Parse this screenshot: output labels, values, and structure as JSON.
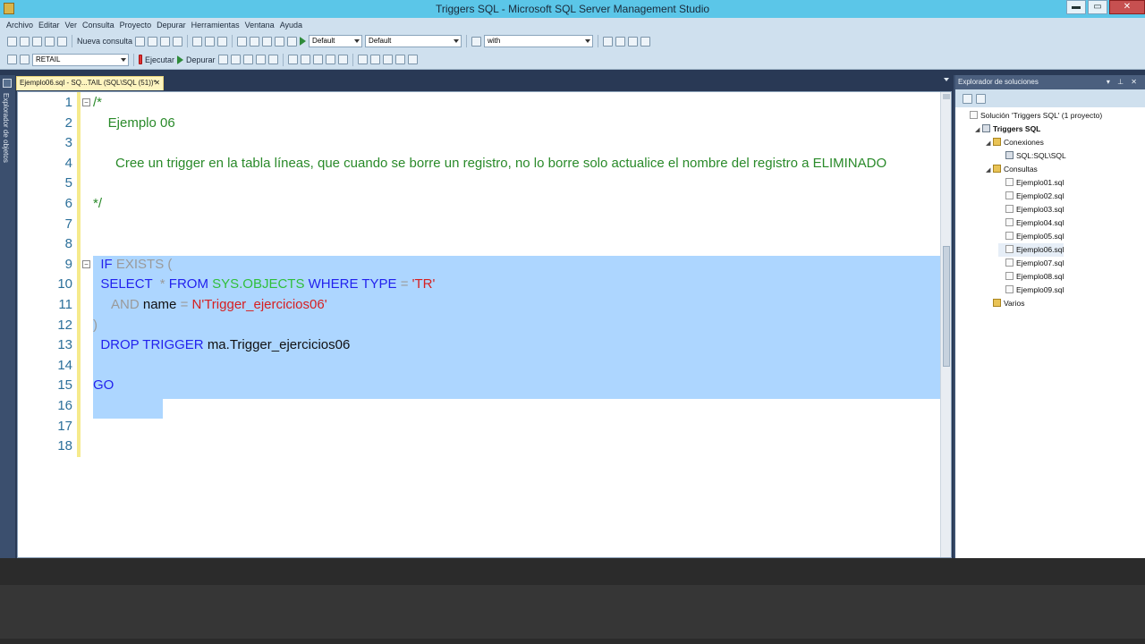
{
  "window": {
    "title": "Triggers SQL - Microsoft SQL Server Management Studio",
    "minimize": "▬",
    "restore": "▭",
    "close": "✕"
  },
  "menu": [
    "Archivo",
    "Editar",
    "Ver",
    "Consulta",
    "Proyecto",
    "Depurar",
    "Herramientas",
    "Ventana",
    "Ayuda"
  ],
  "toolbar1": {
    "new_query": "Nueva consulta",
    "combo1": "Default",
    "combo2": "Default",
    "search": "with"
  },
  "toolbar2": {
    "database": "RETAIL",
    "execute": "Ejecutar",
    "debug": "Depurar"
  },
  "left_strip": {
    "label": "Explorador de objetos"
  },
  "tab": {
    "label": "Ejemplo06.sql - SQ...TAIL (SQL\\SQL (51))*",
    "close": "✕"
  },
  "editor": {
    "line_numbers": [
      "1",
      "2",
      "3",
      "4",
      "5",
      "6",
      "7",
      "8",
      "9",
      "10",
      "11",
      "12",
      "13",
      "14",
      "15",
      "16",
      "17",
      "18"
    ],
    "lines": [
      [
        {
          "t": "/*",
          "c": "cm"
        }
      ],
      [
        {
          "t": "    Ejemplo 06",
          "c": "cm"
        }
      ],
      [],
      [
        {
          "t": "      Cree un trigger en la tabla líneas, que cuando se borre un registro, no lo borre solo actualice el nombre del registro a ELIMINADO",
          "c": "cm"
        }
      ],
      [],
      [
        {
          "t": "*/",
          "c": "cm"
        }
      ],
      [],
      [],
      [
        {
          "t": "  IF ",
          "c": "kw"
        },
        {
          "t": "EXISTS (",
          "c": "gr"
        }
      ],
      [
        {
          "t": "  SELECT  ",
          "c": "kw"
        },
        {
          "t": "* ",
          "c": "gr"
        },
        {
          "t": "FROM ",
          "c": "kw"
        },
        {
          "t": "SYS.OBJECTS ",
          "c": "sys"
        },
        {
          "t": "WHERE TYPE ",
          "c": "kw"
        },
        {
          "t": "= ",
          "c": "gr"
        },
        {
          "t": "'TR'",
          "c": "str"
        }
      ],
      [
        {
          "t": "     AND ",
          "c": "gr"
        },
        {
          "t": "name ",
          "c": "pl"
        },
        {
          "t": "= ",
          "c": "gr"
        },
        {
          "t": "N'Trigger_ejercicios06'",
          "c": "str"
        }
      ],
      [
        {
          "t": ")",
          "c": "gr"
        }
      ],
      [
        {
          "t": "  DROP TRIGGER ",
          "c": "kw"
        },
        {
          "t": "ma.Trigger_ejercicios06",
          "c": "pl"
        }
      ],
      [],
      [
        {
          "t": "GO",
          "c": "kw"
        }
      ],
      [],
      [],
      []
    ]
  },
  "solution_explorer": {
    "title": "Explorador de soluciones",
    "header_buttons": "▾ ⊥ ✕",
    "tree": [
      {
        "label": "Solución 'Triggers SQL' (1 proyecto)",
        "icon": "solution-icon"
      },
      {
        "label": "Triggers SQL",
        "icon": "project-icon"
      },
      {
        "label": "Conexiones",
        "icon": "folder-icon"
      },
      {
        "label": "SQL:SQL\\SQL",
        "icon": "database-icon"
      },
      {
        "label": "Consultas",
        "icon": "folder-icon"
      },
      {
        "label": "Ejemplo01.sql",
        "icon": "sql-file-icon"
      },
      {
        "label": "Ejemplo02.sql",
        "icon": "sql-file-icon"
      },
      {
        "label": "Ejemplo03.sql",
        "icon": "sql-file-icon"
      },
      {
        "label": "Ejemplo04.sql",
        "icon": "sql-file-icon"
      },
      {
        "label": "Ejemplo05.sql",
        "icon": "sql-file-icon"
      },
      {
        "label": "Ejemplo06.sql",
        "icon": "sql-file-icon"
      },
      {
        "label": "Ejemplo07.sql",
        "icon": "sql-file-icon"
      },
      {
        "label": "Ejemplo08.sql",
        "icon": "sql-file-icon"
      },
      {
        "label": "Ejemplo09.sql",
        "icon": "sql-file-icon"
      },
      {
        "label": "Varios",
        "icon": "folder-icon"
      }
    ]
  }
}
